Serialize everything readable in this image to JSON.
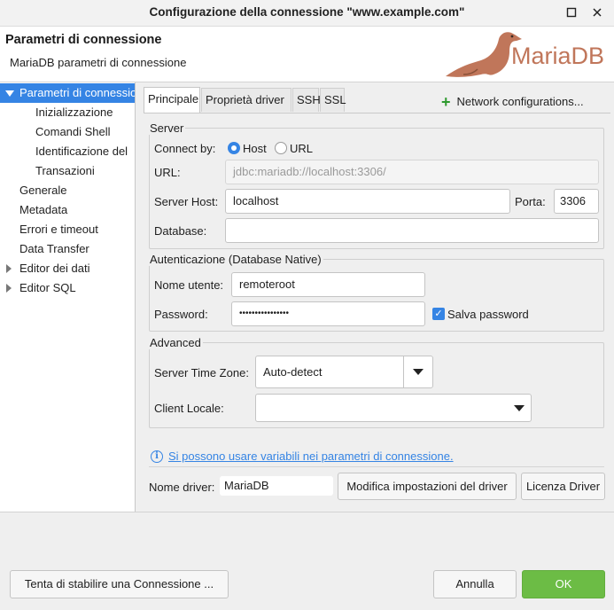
{
  "window": {
    "title": "Configurazione della connessione \"www.example.com\""
  },
  "header": {
    "title": "Parametri di connessione",
    "subtitle": "MariaDB parametri di connessione",
    "logo_text": "MariaDB"
  },
  "tree": {
    "items": [
      {
        "label": "Parametri di connessione"
      },
      {
        "label": "Inizializzazione"
      },
      {
        "label": "Comandi Shell"
      },
      {
        "label": "Identificazione del"
      },
      {
        "label": "Transazioni"
      },
      {
        "label": "Generale"
      },
      {
        "label": "Metadata"
      },
      {
        "label": "Errori e timeout"
      },
      {
        "label": "Data Transfer"
      },
      {
        "label": "Editor dei dati"
      },
      {
        "label": "Editor SQL"
      }
    ]
  },
  "tabs": [
    {
      "label": "Principale"
    },
    {
      "label": "Proprietà driver"
    },
    {
      "label": "SSH"
    },
    {
      "label": "SSL"
    }
  ],
  "network_configurations": "Network configurations...",
  "server": {
    "legend": "Server",
    "connect_by_label": "Connect by:",
    "host_option": "Host",
    "url_option": "URL",
    "url_label": "URL:",
    "url_value": "jdbc:mariadb://localhost:3306/",
    "host_label": "Server Host:",
    "host_value": "localhost",
    "port_label": "Porta:",
    "port_value": "3306",
    "database_label": "Database:",
    "database_value": ""
  },
  "auth": {
    "legend": "Autenticazione (Database Native)",
    "user_label": "Nome utente:",
    "user_value": "remoteroot",
    "password_label": "Password:",
    "password_value": "••••••••••••••••",
    "save_password_label": "Salva password"
  },
  "advanced": {
    "legend": "Advanced",
    "timezone_label": "Server Time Zone:",
    "timezone_value": "Auto-detect",
    "locale_label": "Client Locale:",
    "locale_value": ""
  },
  "info_link": "Si possono usare variabili nei parametri di connessione.",
  "driver": {
    "name_label": "Nome driver:",
    "name_value": "MariaDB",
    "edit_button": "Modifica impostazioni del driver",
    "license_button": "Licenza Driver"
  },
  "footer": {
    "test_button": "Tenta di stabilire una Connessione ...",
    "cancel_button": "Annulla",
    "ok_button": "OK"
  },
  "colors": {
    "accent": "#3584e4",
    "ok": "#6cbc45",
    "plus": "#2e9a2e",
    "logo": "#c0765a"
  }
}
